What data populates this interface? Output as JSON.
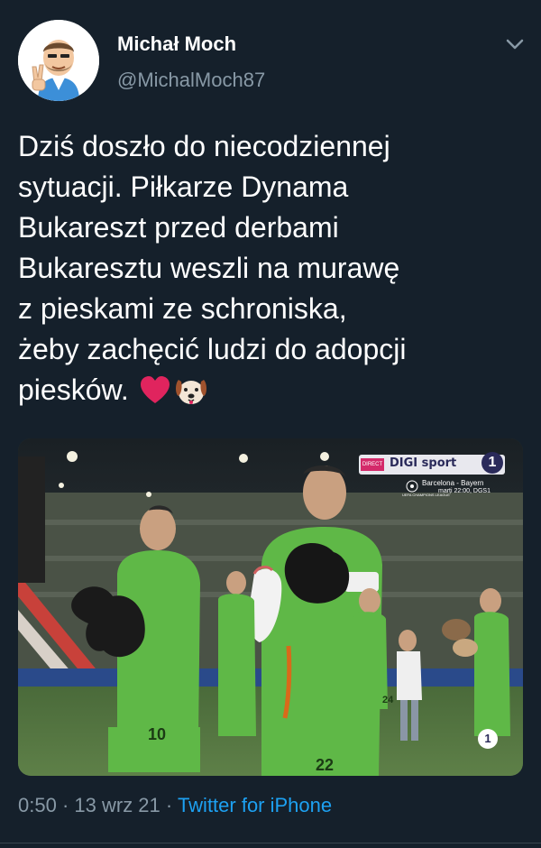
{
  "top_fragment": "· · ·  ·  ·",
  "author": {
    "name": "Michał Moch",
    "handle": "@MichalMoch87"
  },
  "tweet": {
    "lines": [
      "Dziś doszło do niecodziennej",
      "sytuacji. Piłkarze Dynama",
      "Bukareszt przed derbami",
      "Bukaresztu weszli na murawę",
      "z pieskami ze schroniska,",
      "żeby zachęcić ludzi do adopcji",
      "piesków."
    ],
    "emojis": [
      "red-heart",
      "dog-face"
    ]
  },
  "media": {
    "broadcast_tag": "DIRECT",
    "broadcaster": "DIGI sport",
    "channel_number": "1",
    "promo_match": "Barcelona - Bayern",
    "promo_time": "marți 22:00, DGS1",
    "promo_league": "UEFA CHAMPIONS LEAGUE",
    "corner_number": "1",
    "jersey_left": "10",
    "jersey_center": "22",
    "jersey_right": "24"
  },
  "meta": {
    "time": "0:50",
    "separator": " · ",
    "date": "13 wrz 21",
    "source": "Twitter for iPhone"
  },
  "colors": {
    "background": "#15202b",
    "secondary_text": "#8899a6",
    "link": "#1da1f2",
    "heart": "#e0245e",
    "kit_green": "#5fb847"
  }
}
